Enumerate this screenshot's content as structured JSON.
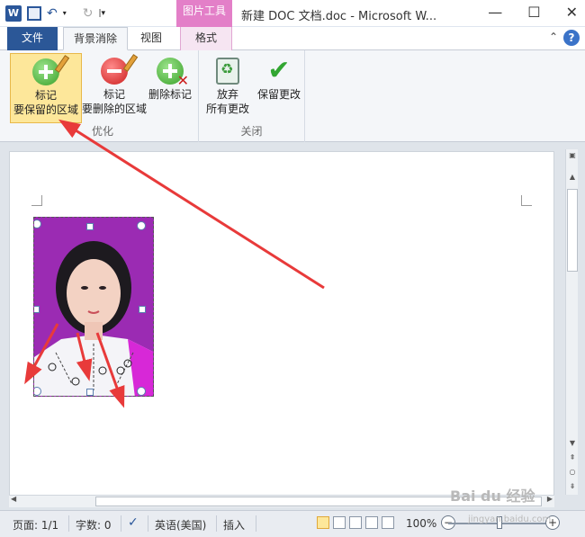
{
  "window": {
    "title": "新建 DOC 文档.doc - Microsoft W...",
    "context_tab_group": "图片工具",
    "app_icon": "W"
  },
  "tabs": {
    "file": "文件",
    "background_removal": "背景消除",
    "view": "视图",
    "format": "格式"
  },
  "ribbon": {
    "groups": {
      "optimize": "优化",
      "close": "关闭"
    },
    "buttons": {
      "mark_keep_line1": "标记",
      "mark_keep_line2": "要保留的区域",
      "mark_remove_line1": "标记",
      "mark_remove_line2": "要删除的区域",
      "delete_mark": "删除标记",
      "discard_line1": "放弃",
      "discard_line2": "所有更改",
      "keep_changes": "保留更改"
    }
  },
  "status": {
    "page": "页面: 1/1",
    "words": "字数: 0",
    "language": "英语(美国)",
    "mode": "插入",
    "zoom": "100%"
  },
  "watermark": {
    "main": "Bai du 经验",
    "sub": "jingyan.baidu.com"
  },
  "colors": {
    "file_tab": "#2b5797",
    "picture_tools": "#e37fc8",
    "highlight": "#fde79a",
    "photo_bg": "#9b2bb3",
    "arrow": "#e83a3a"
  }
}
